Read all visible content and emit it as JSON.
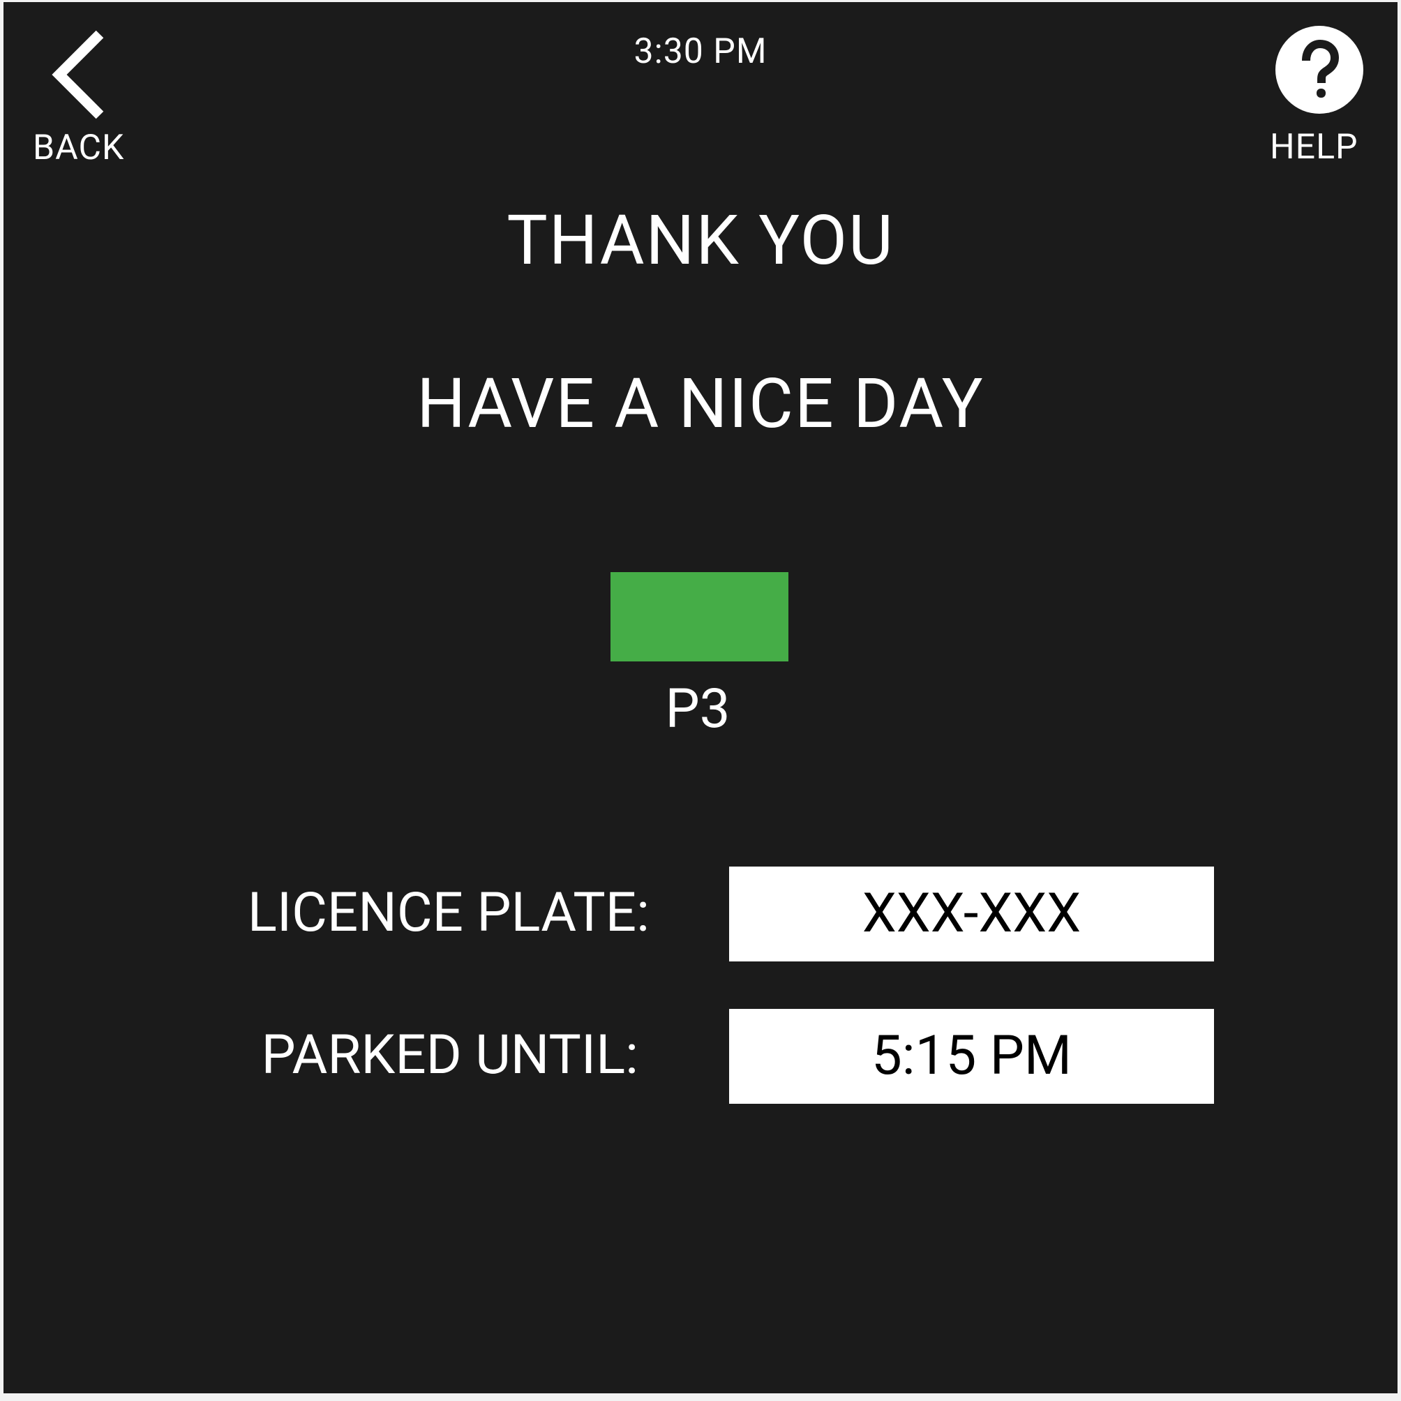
{
  "header": {
    "back_label": "BACK",
    "clock": "3:30 PM",
    "help_label": "HELP"
  },
  "message": {
    "line1": "THANK YOU",
    "line2": "HAVE A NICE DAY"
  },
  "zone": {
    "label": "P3",
    "color": "#45ad47"
  },
  "details": {
    "licence_plate_label": "LICENCE PLATE:",
    "licence_plate_value": "XXX-XXX",
    "parked_until_label": "PARKED UNTIL:",
    "parked_until_value": "5:15 PM"
  },
  "icons": {
    "back": "chevron-left-icon",
    "help": "question-mark-circle-icon"
  },
  "colors": {
    "background": "#1b1b1b",
    "text": "#ffffff",
    "value_box": "#ffffff",
    "value_text": "#000000"
  }
}
